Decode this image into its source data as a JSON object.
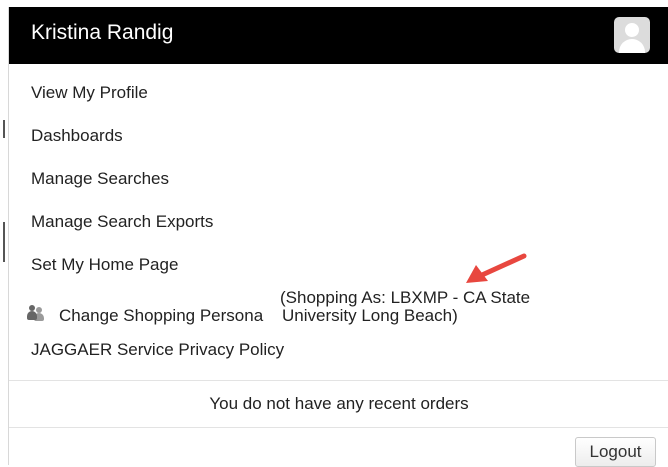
{
  "header": {
    "user_name": "Kristina Randig",
    "avatar_icon": "user-avatar-icon"
  },
  "menu": {
    "items": [
      {
        "label": "View My Profile"
      },
      {
        "label": "Dashboards"
      },
      {
        "label": "Manage Searches"
      },
      {
        "label": "Manage Search Exports"
      },
      {
        "label": "Set My Home Page"
      }
    ],
    "persona": {
      "label": "Change Shopping Persona",
      "shopping_as_prefix": "(Shopping As: LBXMP - CA State",
      "shopping_as_suffix": "University Long Beach)",
      "icon": "persona-icon"
    },
    "privacy_label": "JAGGAER Service Privacy Policy"
  },
  "annotation": {
    "arrow_color": "#e8473f"
  },
  "recent_orders": {
    "message": "You do not have any recent orders"
  },
  "footer": {
    "logout_label": "Logout"
  }
}
